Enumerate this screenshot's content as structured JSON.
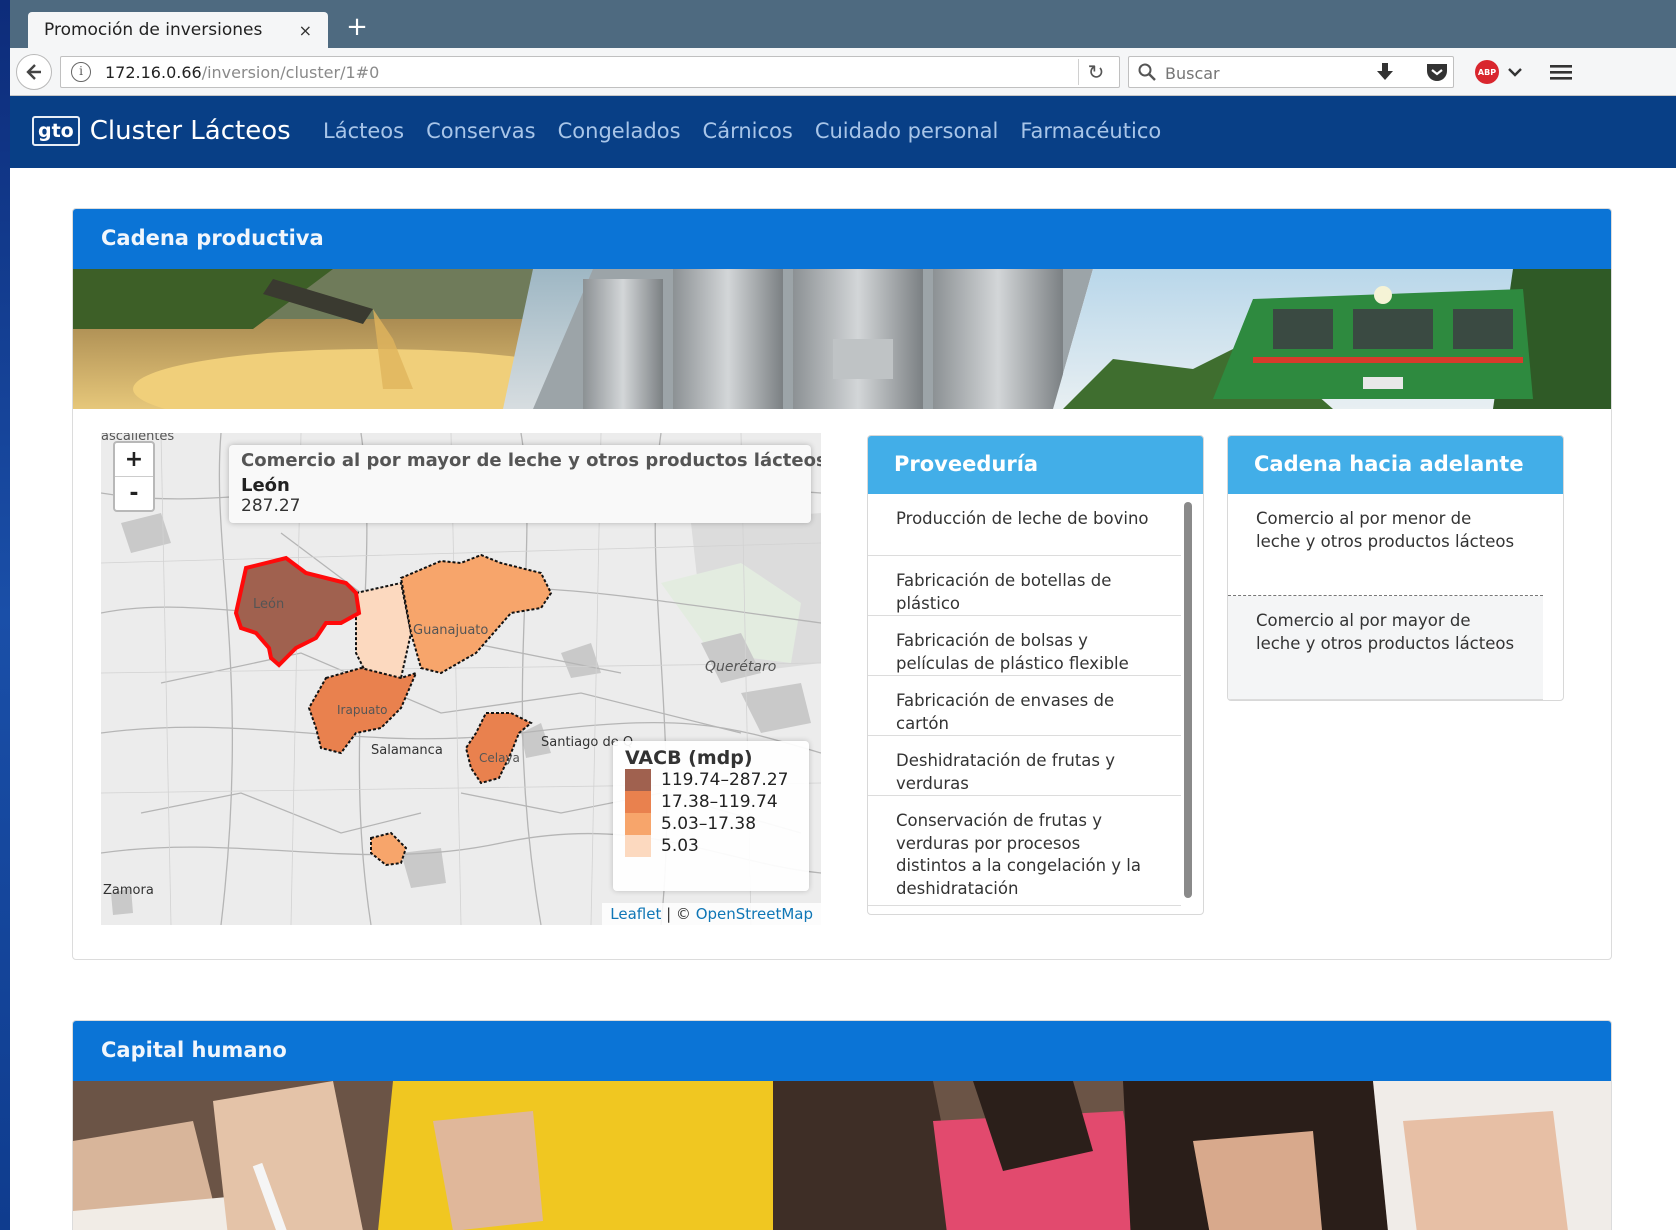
{
  "browser": {
    "tab_title": "Promoción de inversiones",
    "tab_close": "×",
    "new_tab": "+",
    "url_host": "172.16.0.66",
    "url_path": "/inversion/cluster/1#0",
    "search_placeholder": "Buscar",
    "abp_label": "ABP"
  },
  "app": {
    "logo": "gto",
    "title": "Cluster Lácteos",
    "nav": [
      "Lácteos",
      "Conservas",
      "Congelados",
      "Cárnicos",
      "Cuidado personal",
      "Farmacéutico"
    ]
  },
  "cadena": {
    "title": "Cadena productiva",
    "map": {
      "zoom_in": "+",
      "zoom_out": "-",
      "info_title": "Comercio al por mayor de leche y otros productos lácteos",
      "info_name": "León",
      "info_value": "287.27",
      "legend_title": "VACB (mdp)",
      "legend": [
        {
          "label": "119.74–287.27",
          "color": "#a0614f"
        },
        {
          "label": "17.38–119.74",
          "color": "#e9814e"
        },
        {
          "label": "5.03–17.38",
          "color": "#f7a56b"
        },
        {
          "label": "5.03",
          "color": "#fcd9bf"
        }
      ],
      "attribution_leaflet": "Leaflet",
      "attribution_sep": " | © ",
      "attribution_osm": "OpenStreetMap",
      "place_labels": {
        "leon": "León",
        "guanajuato": "Guanajuato",
        "queretaro": "Querétaro",
        "irapuato": "Irapuato",
        "salamanca": "Salamanca",
        "celaya": "Celaya",
        "santiago": "Santiago de Q",
        "zamora": "Zamora",
        "aguascalientes": "ascalientes"
      }
    },
    "proveeduria": {
      "title": "Proveeduría",
      "items": [
        "Producción de leche de bovino",
        "Fabricación de botellas de plástico",
        "Fabricación de bolsas y películas de plástico flexible",
        "Fabricación de envases de cartón",
        "Deshidratación de frutas y verduras",
        "Conservación de frutas y verduras por procesos distintos a la congelación y la deshidratación"
      ]
    },
    "adelante": {
      "title": "Cadena hacia adelante",
      "items": [
        "Comercio al por menor de leche y otros productos lácteos",
        "Comercio al por mayor de leche y otros productos lácteos"
      ]
    }
  },
  "capital": {
    "title": "Capital humano"
  }
}
